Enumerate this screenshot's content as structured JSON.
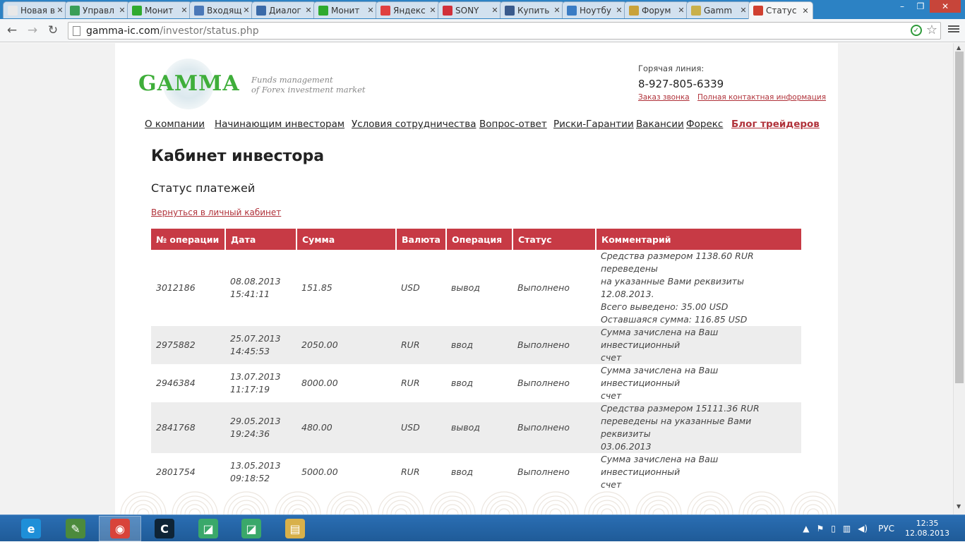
{
  "browser": {
    "tabs": [
      {
        "title": "Новая вкл",
        "icon": "blank-page-icon",
        "color": "#e8e8e8"
      },
      {
        "title": "Управл",
        "icon": "chart-icon",
        "color": "#3a9e58"
      },
      {
        "title": "Монит",
        "icon": "f-logo-icon",
        "color": "#2faa2f"
      },
      {
        "title": "Входящ",
        "icon": "mail-icon",
        "color": "#4a78b8"
      },
      {
        "title": "Диалог",
        "icon": "dialog-icon",
        "color": "#3a6aa8"
      },
      {
        "title": "Монит",
        "icon": "f-logo-icon",
        "color": "#2faa2f"
      },
      {
        "title": "Яндекс",
        "icon": "yandex-icon",
        "color": "#e04040"
      },
      {
        "title": "SONY",
        "icon": "sony-icon",
        "color": "#d0303a"
      },
      {
        "title": "Купить",
        "icon": "n-logo-icon",
        "color": "#395a8c"
      },
      {
        "title": "Ноутбу",
        "icon": "notebook-icon",
        "color": "#3a7cc4"
      },
      {
        "title": "Форум",
        "icon": "forum-icon",
        "color": "#c9a23a"
      },
      {
        "title": "Gamm",
        "icon": "gamma-icon",
        "color": "#c9b04a"
      },
      {
        "title": "Статус",
        "icon": "bars-icon",
        "color": "#d04030"
      }
    ],
    "tab_close": "✕",
    "win_min": "–",
    "win_max": "❐",
    "win_close": "✕",
    "url_host": "gamma-ic.com",
    "url_path": "/investor/status.php"
  },
  "site": {
    "logo": "GAMMA",
    "tagline_1": "Funds management",
    "tagline_2": "of Forex investment market",
    "hotline_label": "Горячая линия:",
    "hotline_phone": "8-927-805-6339",
    "link_callback": "Заказ звонка",
    "link_contacts": "Полная контактная информация",
    "nav": [
      "О компании",
      "Начинающим инвесторам",
      "Условия сотрудничества",
      "Вопрос-ответ",
      "Риски-Гарантии",
      "Вакансии",
      "Форекс",
      "Блог трейдеров"
    ]
  },
  "main": {
    "title": "Кабинет инвестора",
    "subtitle": "Статус платежей",
    "back_link": "Вернуться в личный кабинет",
    "columns": [
      "№ операции",
      "Дата",
      "Сумма",
      "Валюта",
      "Операция",
      "Статус",
      "Комментарий"
    ],
    "rows": [
      {
        "id": "3012186",
        "date": "08.08.2013",
        "time": "15:41:11",
        "amount": "151.85",
        "currency": "USD",
        "operation": "вывод",
        "status": "Выполнено",
        "comment": [
          "Средства размером 1138.60 RUR переведены",
          "на указанные Вами реквизиты 12.08.2013.",
          "Всего выведено: 35.00 USD",
          "Оставшаяся сумма: 116.85 USD"
        ]
      },
      {
        "id": "2975882",
        "date": "25.07.2013",
        "time": "14:45:53",
        "amount": "2050.00",
        "currency": "RUR",
        "operation": "ввод",
        "status": "Выполнено",
        "comment": [
          "Сумма зачислена на Ваш инвестиционный",
          "счет"
        ]
      },
      {
        "id": "2946384",
        "date": "13.07.2013",
        "time": "11:17:19",
        "amount": "8000.00",
        "currency": "RUR",
        "operation": "ввод",
        "status": "Выполнено",
        "comment": [
          "Сумма зачислена на Ваш инвестиционный",
          "счет"
        ]
      },
      {
        "id": "2841768",
        "date": "29.05.2013",
        "time": "19:24:36",
        "amount": "480.00",
        "currency": "USD",
        "operation": "вывод",
        "status": "Выполнено",
        "comment": [
          "Средства размером 15111.36 RUR",
          "переведены на указанные Вами реквизиты",
          "03.06.2013"
        ]
      },
      {
        "id": "2801754",
        "date": "13.05.2013",
        "time": "09:18:52",
        "amount": "5000.00",
        "currency": "RUR",
        "operation": "ввод",
        "status": "Выполнено",
        "comment": [
          "Сумма зачислена на Ваш инвестиционный",
          "счет"
        ]
      }
    ]
  },
  "taskbar": {
    "apps": [
      {
        "name": "internet-explorer-icon",
        "glyph": "e",
        "color": "#1e8fd8"
      },
      {
        "name": "notepad-chart-icon",
        "glyph": "✎",
        "color": "#4c8a3c"
      },
      {
        "name": "chrome-icon",
        "glyph": "◉",
        "color": "#d8433a"
      },
      {
        "name": "c-app-icon",
        "glyph": "C",
        "color": "#0f2436"
      },
      {
        "name": "terminal-app-icon",
        "glyph": "◪",
        "color": "#3aa86a"
      },
      {
        "name": "terminal-app-icon-2",
        "glyph": "◪",
        "color": "#3aa86a"
      },
      {
        "name": "explorer-folder-icon",
        "glyph": "▤",
        "color": "#d8b04a"
      }
    ],
    "lang": "РУС",
    "time": "12:35",
    "date": "12.08.2013"
  }
}
